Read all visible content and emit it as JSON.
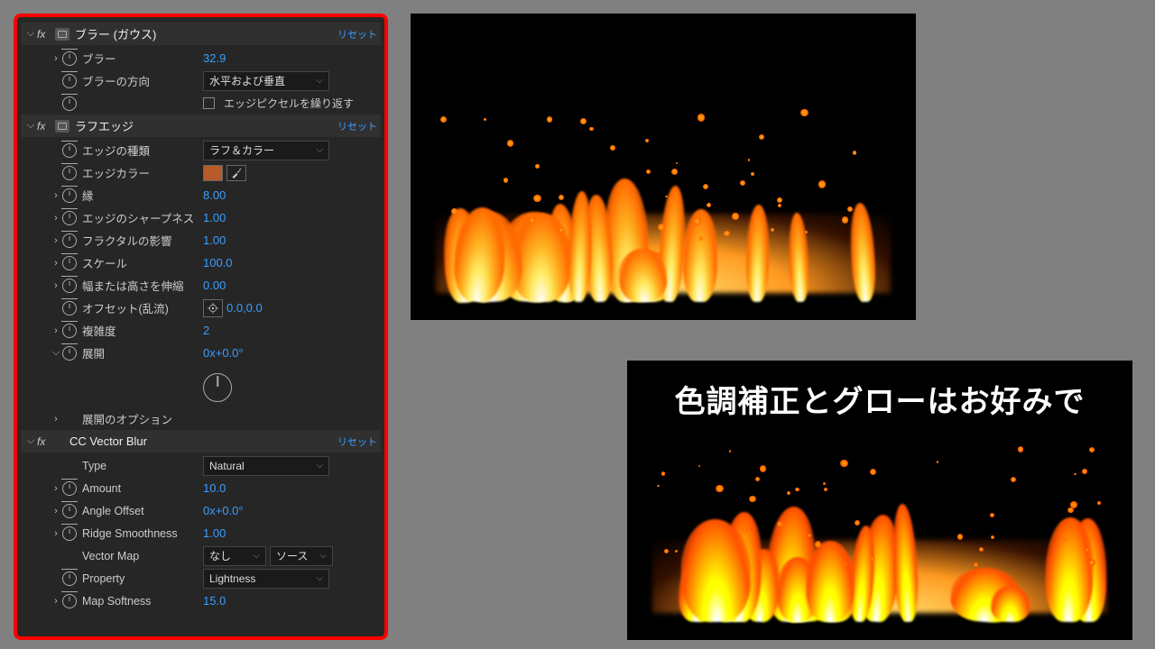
{
  "effects": {
    "gaussian_blur": {
      "name": "ブラー (ガウス)",
      "reset": "リセット",
      "blur_label": "ブラー",
      "blur_value": "32.9",
      "direction_label": "ブラーの方向",
      "direction_value": "水平および垂直",
      "repeat_edge_label": "エッジピクセルを繰り返す"
    },
    "roughen_edges": {
      "name": "ラフエッジ",
      "reset": "リセット",
      "edge_type_label": "エッジの種類",
      "edge_type_value": "ラフ＆カラー",
      "edge_color_label": "エッジカラー",
      "edge_color_value": "#b85a2a",
      "border_label": "縁",
      "border_value": "8.00",
      "sharpness_label": "エッジのシャープネス",
      "sharpness_value": "1.00",
      "fractal_label": "フラクタルの影響",
      "fractal_value": "1.00",
      "scale_label": "スケール",
      "scale_value": "100.0",
      "stretch_label": "幅または高さを伸縮",
      "stretch_value": "0.00",
      "offset_label": "オフセット(乱流)",
      "offset_value": "0.0,0.0",
      "complexity_label": "複雑度",
      "complexity_value": "2",
      "evolution_label": "展開",
      "evolution_value": "0x+0.0°",
      "evolution_options_label": "展開のオプション"
    },
    "cc_vector_blur": {
      "name": "CC Vector Blur",
      "reset": "リセット",
      "type_label": "Type",
      "type_value": "Natural",
      "amount_label": "Amount",
      "amount_value": "10.0",
      "angle_offset_label": "Angle Offset",
      "angle_offset_value": "0x+0.0°",
      "ridge_label": "Ridge Smoothness",
      "ridge_value": "1.00",
      "vector_map_label": "Vector Map",
      "vector_map_value": "なし",
      "vector_map_source": "ソース",
      "property_label": "Property",
      "property_value": "Lightness",
      "map_softness_label": "Map Softness",
      "map_softness_value": "15.0"
    }
  },
  "overlay_caption": "色調補正とグローはお好みで"
}
